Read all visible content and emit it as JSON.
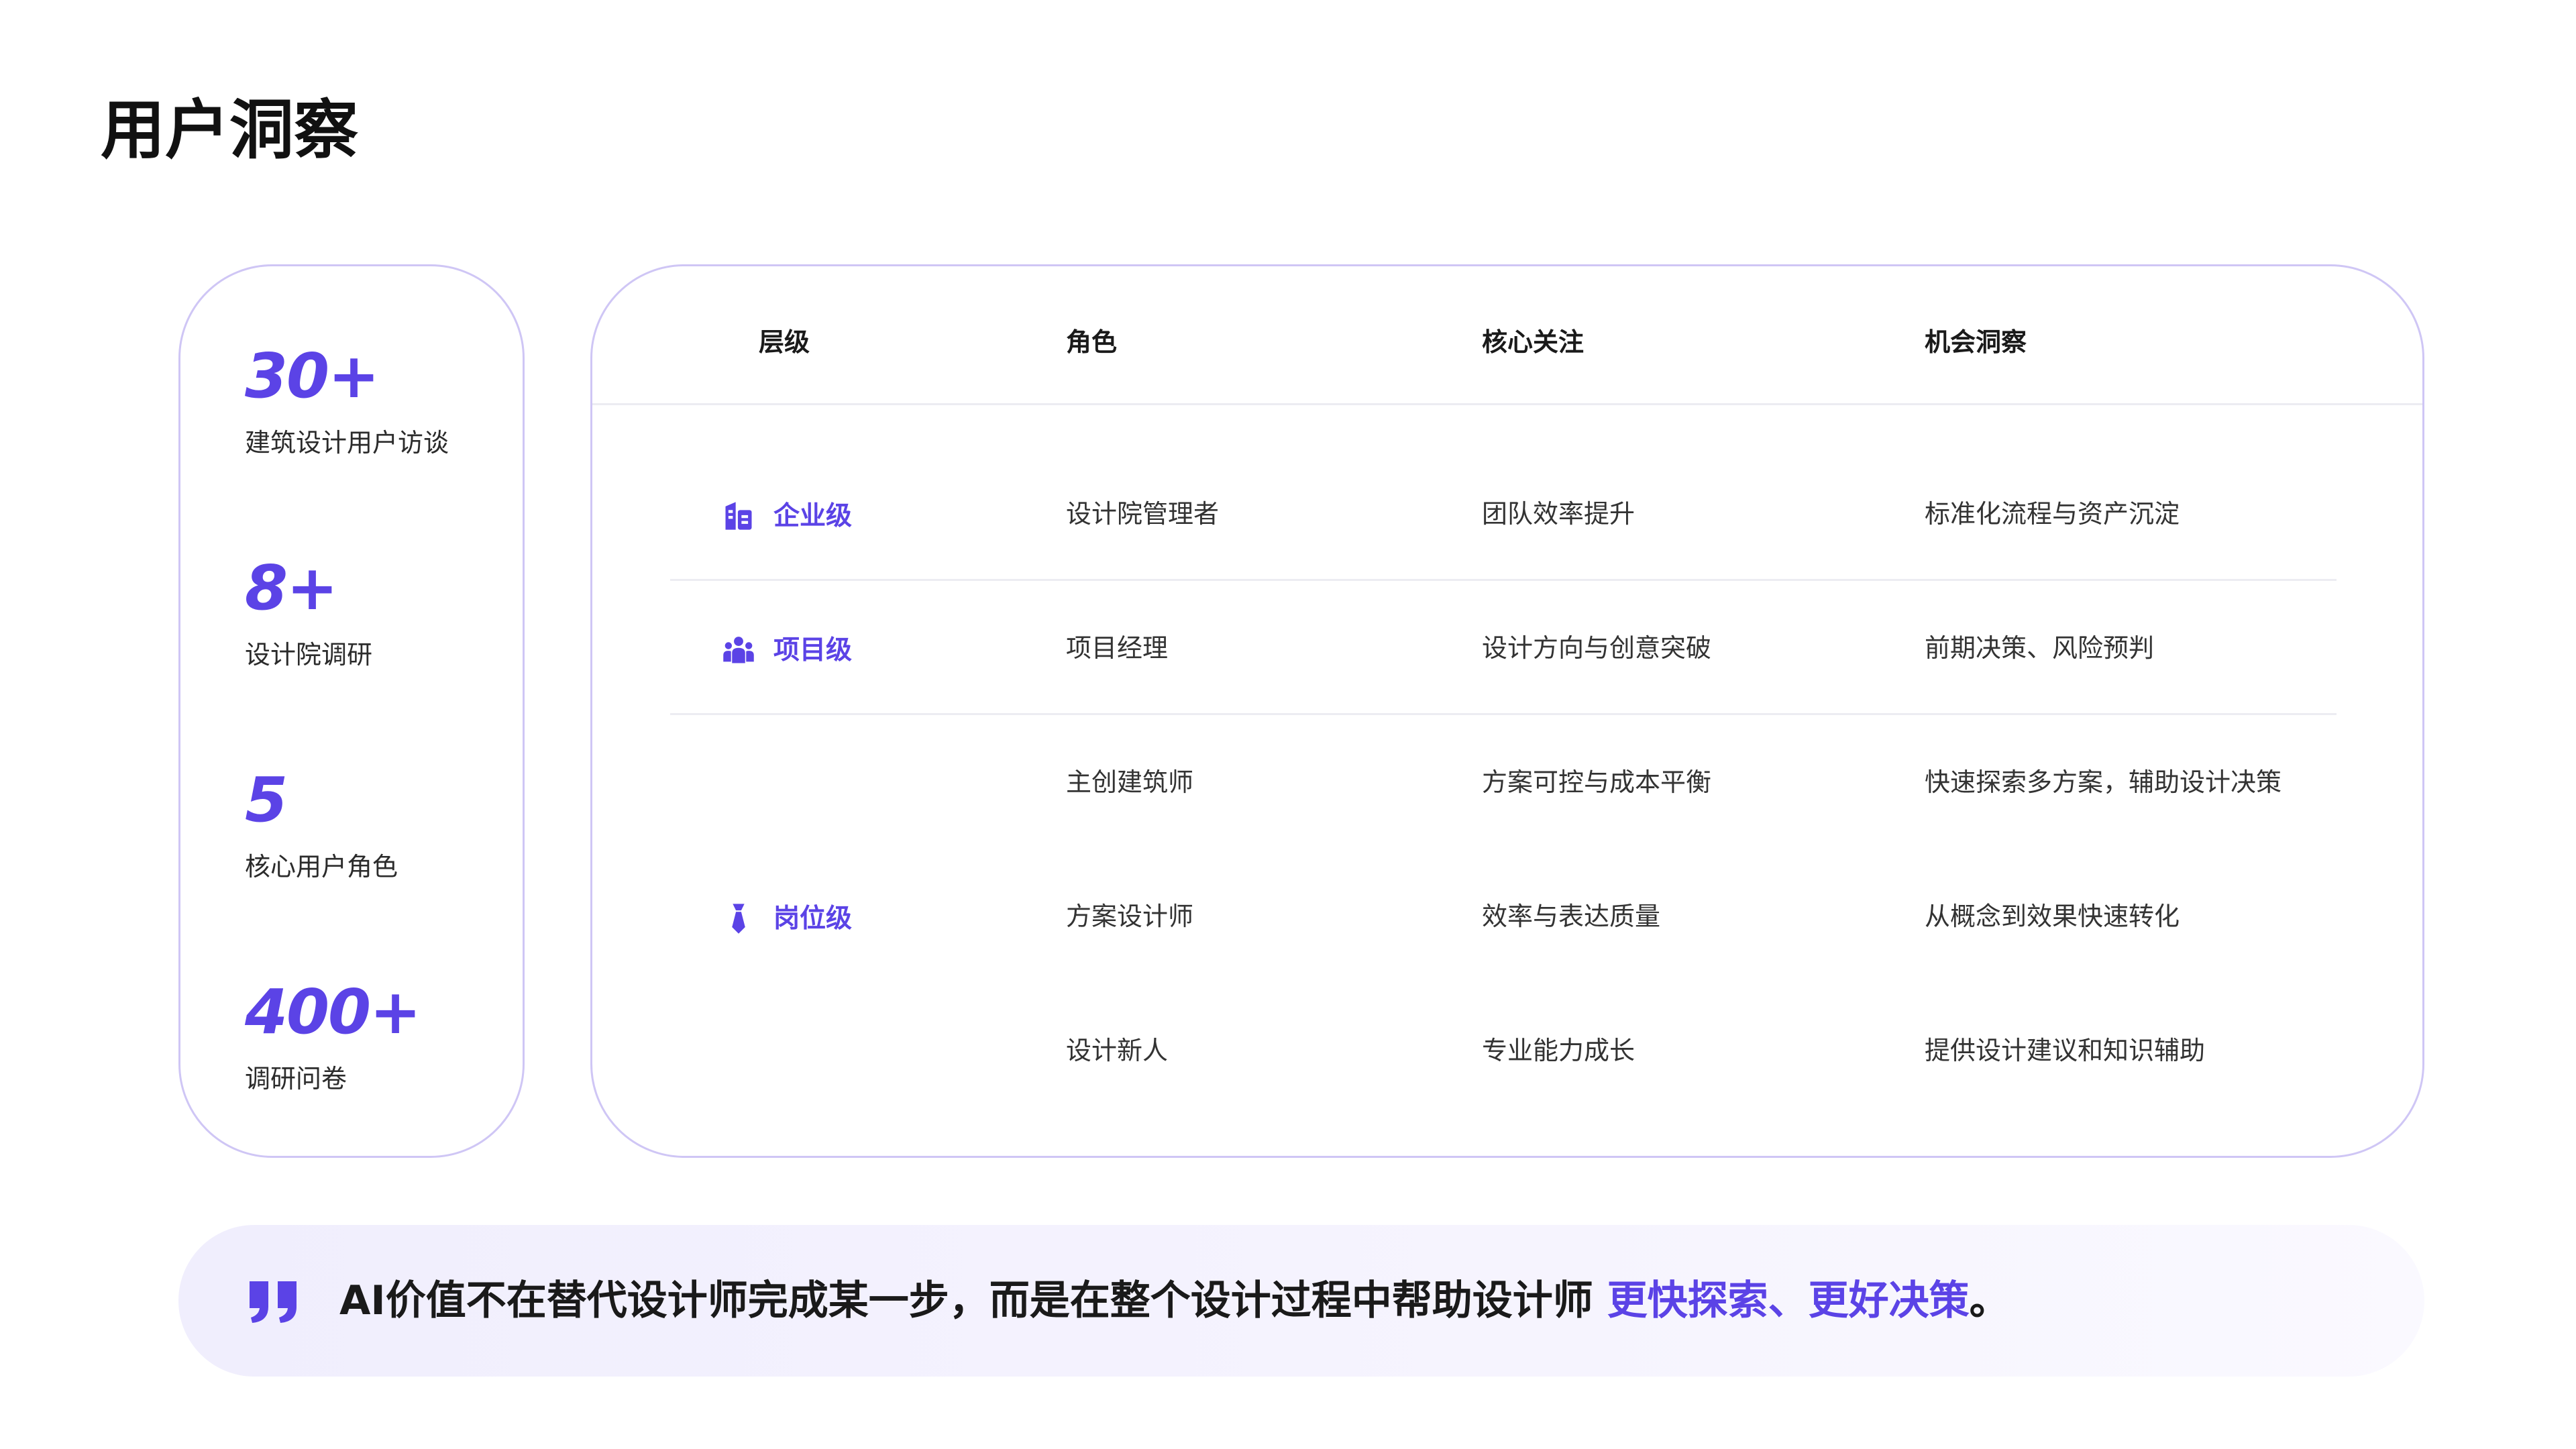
{
  "page": {
    "title": "用户洞察"
  },
  "stats": [
    {
      "value": "30+",
      "label": "建筑设计用户访谈"
    },
    {
      "value": "8+",
      "label": "设计院调研"
    },
    {
      "value": "5",
      "label": "核心用户角色"
    },
    {
      "value": "400+",
      "label": "调研问卷"
    }
  ],
  "table": {
    "headers": [
      "层级",
      "角色",
      "核心关注",
      "机会洞察"
    ],
    "levels": [
      {
        "label": "企业级",
        "icon": "building-icon"
      },
      {
        "label": "项目级",
        "icon": "team-icon"
      },
      {
        "label": "岗位级",
        "icon": "tie-icon"
      }
    ],
    "rows": [
      {
        "role": "设计院管理者",
        "focus": "团队效率提升",
        "insight": "标准化流程与资产沉淀"
      },
      {
        "role": "项目经理",
        "focus": "设计方向与创意突破",
        "insight": "前期决策、风险预判"
      },
      {
        "role": "主创建筑师",
        "focus": "方案可控与成本平衡",
        "insight": "快速探索多方案，辅助设计决策"
      },
      {
        "role": "方案设计师",
        "focus": "效率与表达质量",
        "insight": "从概念到效果快速转化"
      },
      {
        "role": "设计新人",
        "focus": "专业能力成长",
        "insight": "提供设计建议和知识辅助"
      }
    ]
  },
  "quote": {
    "text": "AI价值不在替代设计师完成某一步，而是在整个设计过程中帮助设计师 ",
    "highlight": "更快探索、更好决策",
    "end": "。",
    "icon": "quote-icon"
  },
  "colors": {
    "accent": "#5b43e6",
    "border": "#cfc6f5",
    "banner": "#f3f1fd"
  }
}
